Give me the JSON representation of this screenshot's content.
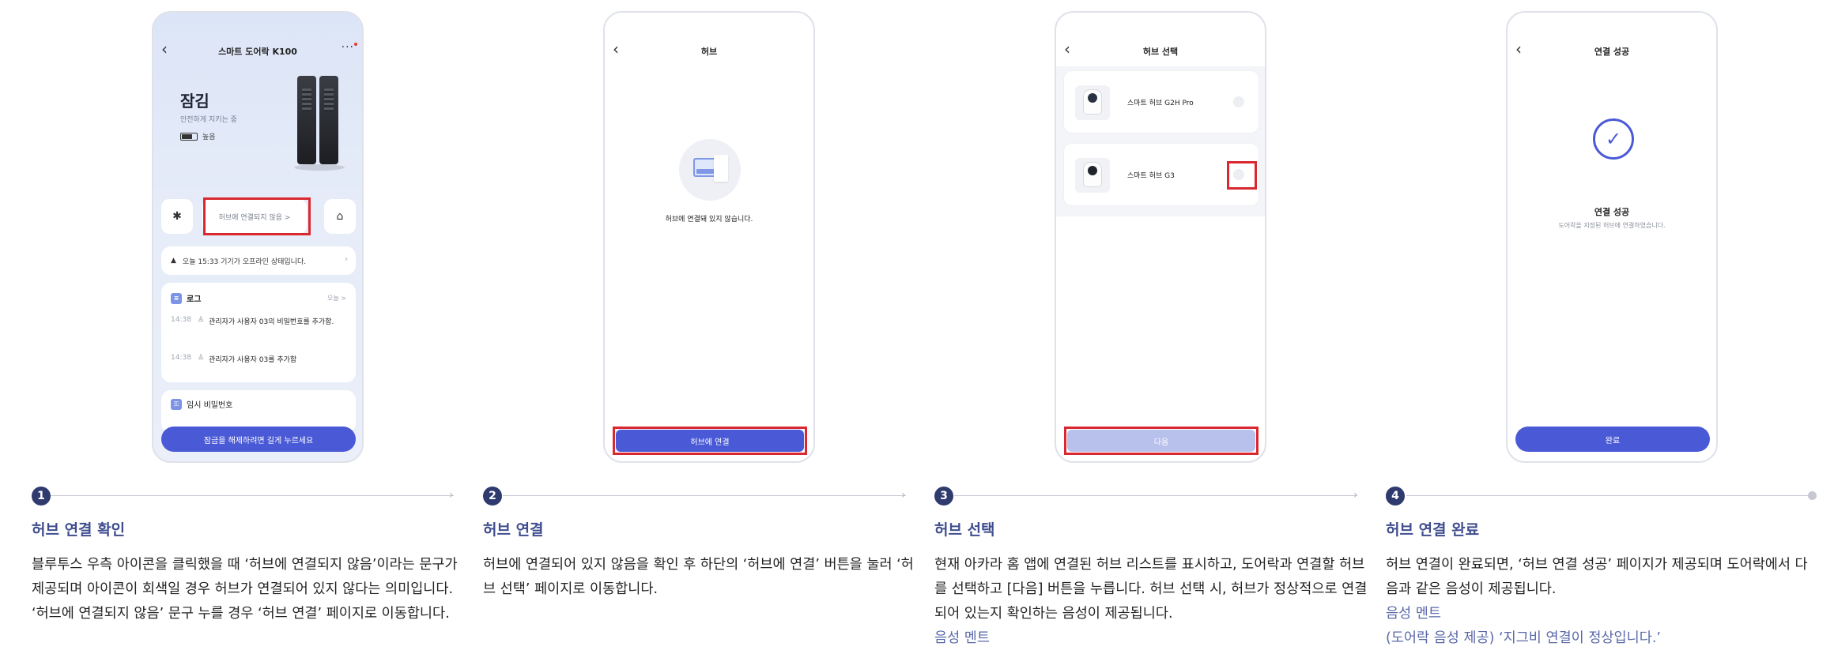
{
  "phone1": {
    "title": "스마트 도어락 K100",
    "lock_state": "잠김",
    "lock_sub": "안전하게 지키는 중",
    "battery": "높음",
    "hub_status": "허브에 연결되지 않음 >",
    "notice": "오늘 15:33 기기가 오프라인 상태입니다.",
    "log_title": "로그",
    "log_today": "오늘 >",
    "log_rows": [
      {
        "time": "14:38",
        "text": "관리자가 사용자 03의 비밀번호를 추가함."
      },
      {
        "time": "14:38",
        "text": "관리자가 사용자 03를 추가함"
      }
    ],
    "temp_title": "임시 비밀번호",
    "cta": "잠금을 해제하려면 길게 누르세요"
  },
  "phone2": {
    "title": "허브",
    "message": "허브에 연결돼 있지 않습니다.",
    "button": "허브에 연결"
  },
  "phone3": {
    "title": "허브 선택",
    "hubs": [
      {
        "name": "스마트 허브 G2H Pro"
      },
      {
        "name": "스마트 허브 G3"
      }
    ],
    "button": "다음"
  },
  "phone4": {
    "title": "연결 성공",
    "success_title": "연결 성공",
    "success_sub": "도어락을 지정된 허브에 연결하였습니다.",
    "button": "완료"
  },
  "steps": [
    {
      "num": "1",
      "title": "허브 연결 확인",
      "desc": "블루투스 우측 아이콘을 클릭했을 때 ‘허브에 연결되지 않음’이라는 문구가 제공되며 아이콘이 회색일 경우 허브가 연결되어 있지 않다는 의미입니다. ‘허브에 연결되지 않음’ 문구 누를 경우 ‘허브 연결’ 페이지로 이동합니다."
    },
    {
      "num": "2",
      "title": "허브 연결",
      "desc": "허브에 연결되어 있지 않음을 확인 후 하단의 ‘허브에 연결’ 버튼을 눌러 ‘허브 선택’ 페이지로 이동합니다."
    },
    {
      "num": "3",
      "title": "허브 선택",
      "desc": "현재 아카라 홈 앱에 연결된 허브 리스트를 표시하고, 도어락과 연결할 허브를 선택하고 [다음] 버튼을 누릅니다. 허브 선택 시, 허브가 정상적으로 연결되어 있는지 확인하는 음성이 제공됩니다.",
      "highlight": "음성 멘트"
    },
    {
      "num": "4",
      "title": "허브 연결 완료",
      "desc": "허브 연결이 완료되면, ‘허브 연결 성공’ 페이지가 제공되며 도어락에서 다음과 같은 음성이 제공됩니다.",
      "highlight": "음성 멘트",
      "highlight2": "(도어락 음성 제공) ‘지그비 연결이 정상입니다.’"
    }
  ],
  "colors": {
    "accent": "#4a5ad6",
    "step_title": "#3f4d8e",
    "highlight_box": "#d9282f"
  }
}
